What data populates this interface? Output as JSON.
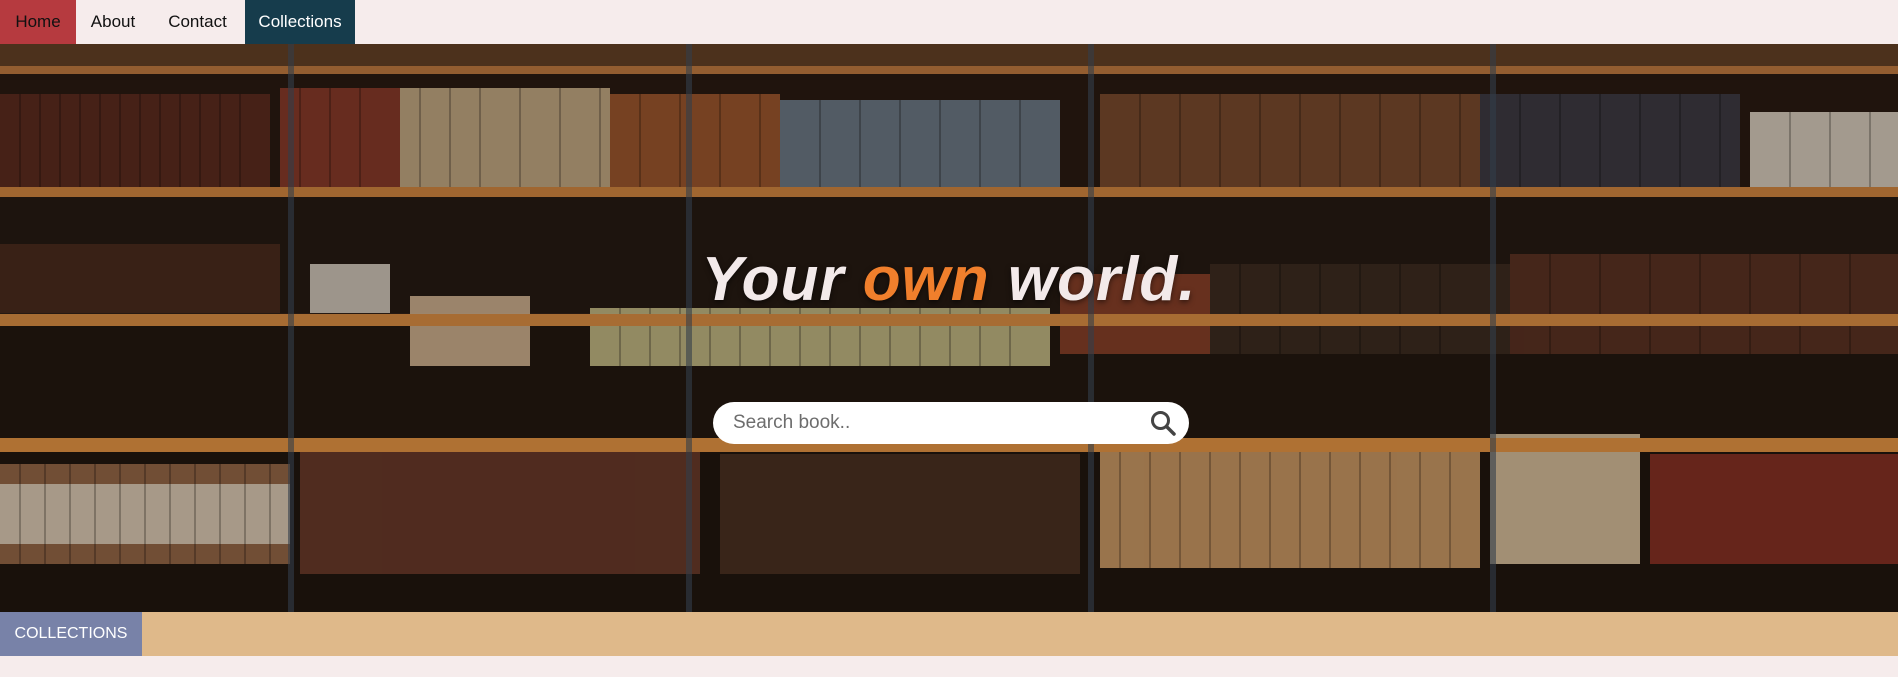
{
  "nav": {
    "items": [
      {
        "label": "Home"
      },
      {
        "label": "About"
      },
      {
        "label": "Contact"
      },
      {
        "label": "Collections"
      }
    ]
  },
  "hero": {
    "headline_before": "Your ",
    "headline_accent": "own",
    "headline_after": " world.",
    "accent_color": "#f07f2c"
  },
  "search": {
    "placeholder": "Search book.."
  },
  "collections_bar": {
    "tab_label": "COLLECTIONS"
  },
  "colors": {
    "nav_home_bg": "#b63a3f",
    "nav_collections_bg": "#163c4c",
    "collections_tab_bg": "#7882a8",
    "collections_bar_bg": "#dfb98a",
    "page_bg": "#f6ecec"
  }
}
